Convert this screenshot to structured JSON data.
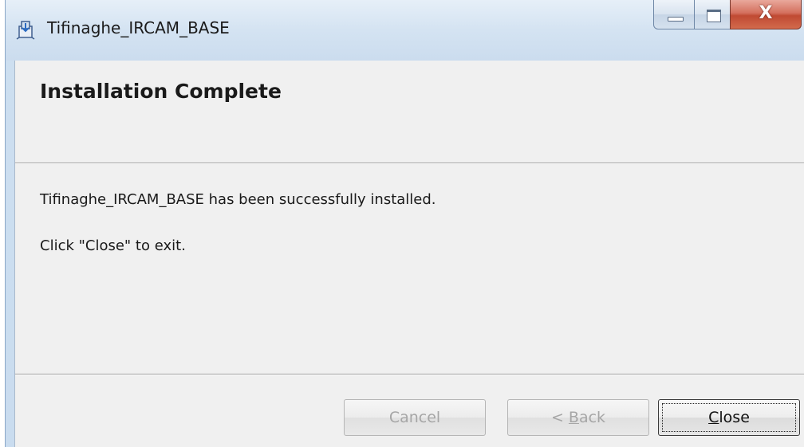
{
  "window": {
    "title": "Tifinaghe_IRCAM_BASE",
    "icon": "installer-icon",
    "controls": {
      "minimize": "minimize-icon",
      "maximize": "maximize-icon",
      "close": "close-icon",
      "close_glyph": "X"
    }
  },
  "header": {
    "title": "Installation Complete"
  },
  "body": {
    "message": "Tifinaghe_IRCAM_BASE has been successfully installed.",
    "instruction": "Click \"Close\" to exit."
  },
  "buttons": {
    "cancel": {
      "label": "Cancel",
      "enabled": false
    },
    "back": {
      "prefix": "< ",
      "mnemonic": "B",
      "rest": "ack",
      "enabled": false
    },
    "close": {
      "mnemonic": "C",
      "rest": "lose",
      "enabled": true,
      "default": true
    }
  },
  "colors": {
    "close_button_red": "#c04a33",
    "dialog_background": "#f0f0f0",
    "disabled_text": "#a6a6a6"
  }
}
